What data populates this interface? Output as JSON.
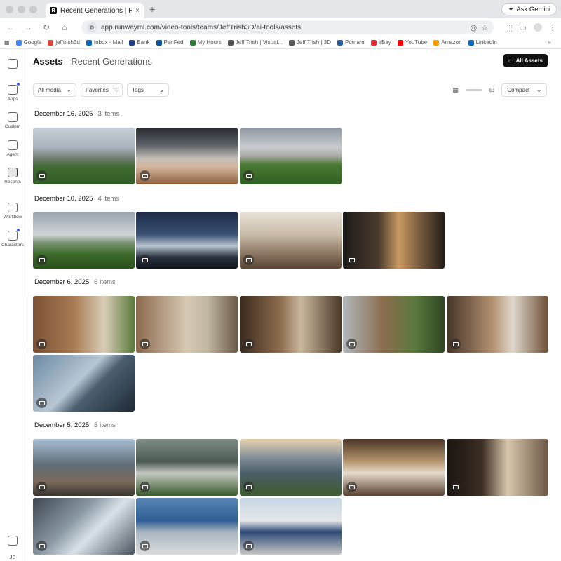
{
  "browser": {
    "tab_title": "Recent Generations | Runway",
    "tab_close": "×",
    "new_tab": "+",
    "ask_gemini": "Ask Gemini",
    "url": "app.runwayml.com/video-tools/teams/JeffTrish3D/ai-tools/assets",
    "bookmarks": [
      {
        "label": "Google",
        "color": "#4285f4"
      },
      {
        "label": "jefftrish3d",
        "color": "#d44638"
      },
      {
        "label": "Inbox - Mail",
        "color": "#0a66c2"
      },
      {
        "label": "Bank",
        "color": "#1f3c88"
      },
      {
        "label": "PenFed",
        "color": "#0b5394"
      },
      {
        "label": "My Hours",
        "color": "#2e7d32"
      },
      {
        "label": "Jeff Trish | Visual...",
        "color": "#555555"
      },
      {
        "label": "Jeff Trish | 3D",
        "color": "#555555"
      },
      {
        "label": "Putnam",
        "color": "#2f5aa8"
      },
      {
        "label": "eBay",
        "color": "#e53238"
      },
      {
        "label": "YouTube",
        "color": "#ff0000"
      },
      {
        "label": "Amazon",
        "color": "#ff9900"
      },
      {
        "label": "LinkedIn",
        "color": "#0a66c2"
      }
    ],
    "bookmarks_overflow": "»"
  },
  "sidebar": {
    "items": [
      {
        "label": "Apps",
        "dot": true
      },
      {
        "label": "Custom",
        "dot": false
      },
      {
        "label": "Agent",
        "dot": false
      },
      {
        "label": "Recents",
        "dot": false,
        "active": true
      },
      {
        "label": "Workflow",
        "dot": false
      },
      {
        "label": "Characters",
        "dot": true
      }
    ],
    "user_initials": "JE"
  },
  "header": {
    "title": "Assets",
    "separator": "·",
    "subtitle": "Recent Generations",
    "all_assets_label": "All Assets"
  },
  "filters": {
    "media": "All media",
    "favorites": "Favorites",
    "tags": "Tags",
    "view_mode": "Compact"
  },
  "sections": [
    {
      "date": "December 16, 2025",
      "count": "3 items"
    },
    {
      "date": "December 10, 2025",
      "count": "4 items"
    },
    {
      "date": "December 6, 2025",
      "count": "6 items"
    },
    {
      "date": "December 5, 2025",
      "count": "8 items"
    }
  ],
  "colors": {
    "accent": "#111111",
    "notification_dot": "#3b5bdb"
  }
}
